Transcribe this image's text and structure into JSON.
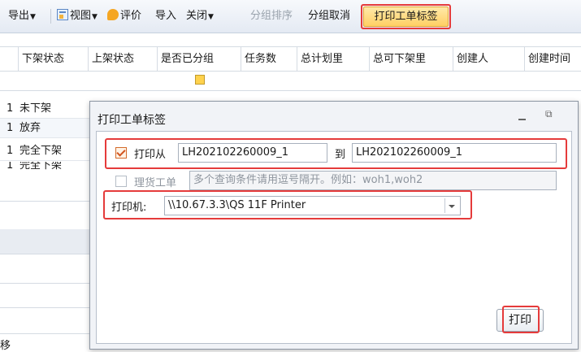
{
  "toolbar": {
    "export_label": "导出",
    "view_label": "视图",
    "evaluate_label": "评价",
    "import_label": "导入",
    "close_label": "关闭",
    "group_sort_label": "分组排序",
    "ungroup_label": "分组取消",
    "print_ticket_label": "打印工单标签"
  },
  "grid": {
    "columns": [
      "下架状态",
      "上架状态",
      "是否已分组",
      "任务数",
      "总计划里",
      "总可下架里",
      "创建人",
      "创建时间"
    ],
    "rows": [
      {
        "num": "1",
        "status": "未下架"
      },
      {
        "num": "1",
        "status": "放弃"
      },
      {
        "num": "1",
        "status": "完全下架"
      },
      {
        "num": "1",
        "status": "完全下架"
      }
    ],
    "bottom_char": "移"
  },
  "dialog": {
    "title": "打印工单标签",
    "print_from_label": "打印从",
    "from_value": "LH202102260009_1",
    "to_label": "到",
    "to_value": "LH202102260009_1",
    "print_from_checked": true,
    "ticket_label": "理货工单",
    "ticket_placeholder": "多个查询条件请用逗号隔开。例如：woh1,woh2",
    "ticket_checked": false,
    "printer_label": "打印机:",
    "printer_value": "\\\\10.67.3.3\\QS 11F Printer",
    "print_button": "打印",
    "highlight_color": "#e53b3b"
  }
}
